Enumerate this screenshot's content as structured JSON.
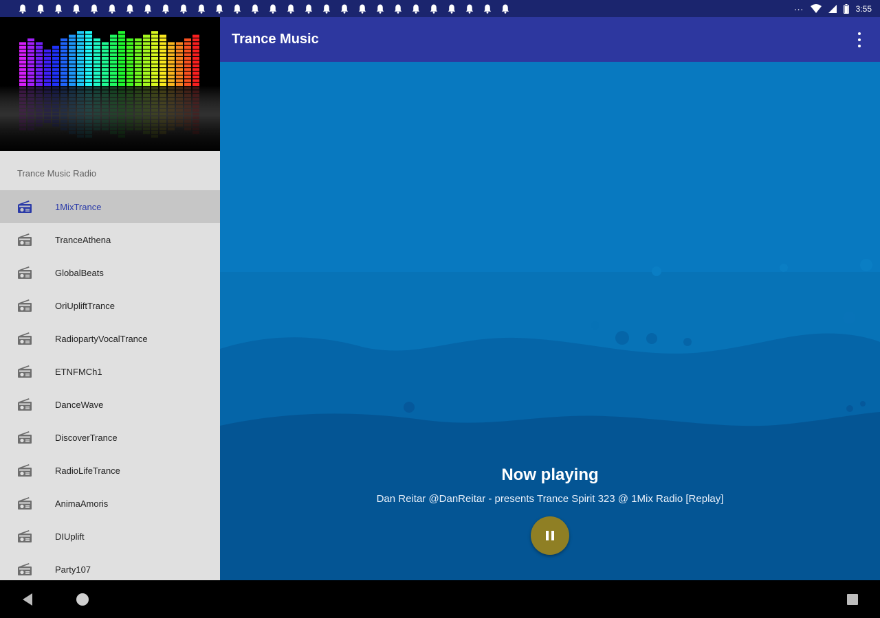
{
  "status_bar": {
    "notification_count": 28,
    "notification_icon": "bell-icon",
    "overflow_text": "···",
    "time": "3:55"
  },
  "drawer": {
    "subheader": "Trance Music Radio",
    "stations": [
      {
        "label": "1MixTrance",
        "active": true
      },
      {
        "label": "TranceAthena"
      },
      {
        "label": "GlobalBeats"
      },
      {
        "label": "OriUpliftTrance"
      },
      {
        "label": "RadiopartyVocalTrance"
      },
      {
        "label": "ETNFMCh1"
      },
      {
        "label": "DanceWave"
      },
      {
        "label": "DiscoverTrance"
      },
      {
        "label": "RadioLifeTrance"
      },
      {
        "label": "AnimaAmoris"
      },
      {
        "label": "DIUplift"
      },
      {
        "label": "Party107"
      }
    ]
  },
  "app_bar": {
    "title": "Trance Music"
  },
  "player": {
    "heading": "Now playing",
    "track": "Dan Reitar @DanReitar - presents Trance Spirit 323 @ 1Mix Radio [Replay]"
  },
  "colors": {
    "status_bar": "#1b256e",
    "app_bar": "#2d379f",
    "drawer_bg": "#e0e0e0",
    "active_item_bg": "#c6c6c6",
    "active_item_text": "#2a3aa8",
    "content_top": "#0879c0",
    "pause_button": "#8f7f24"
  }
}
